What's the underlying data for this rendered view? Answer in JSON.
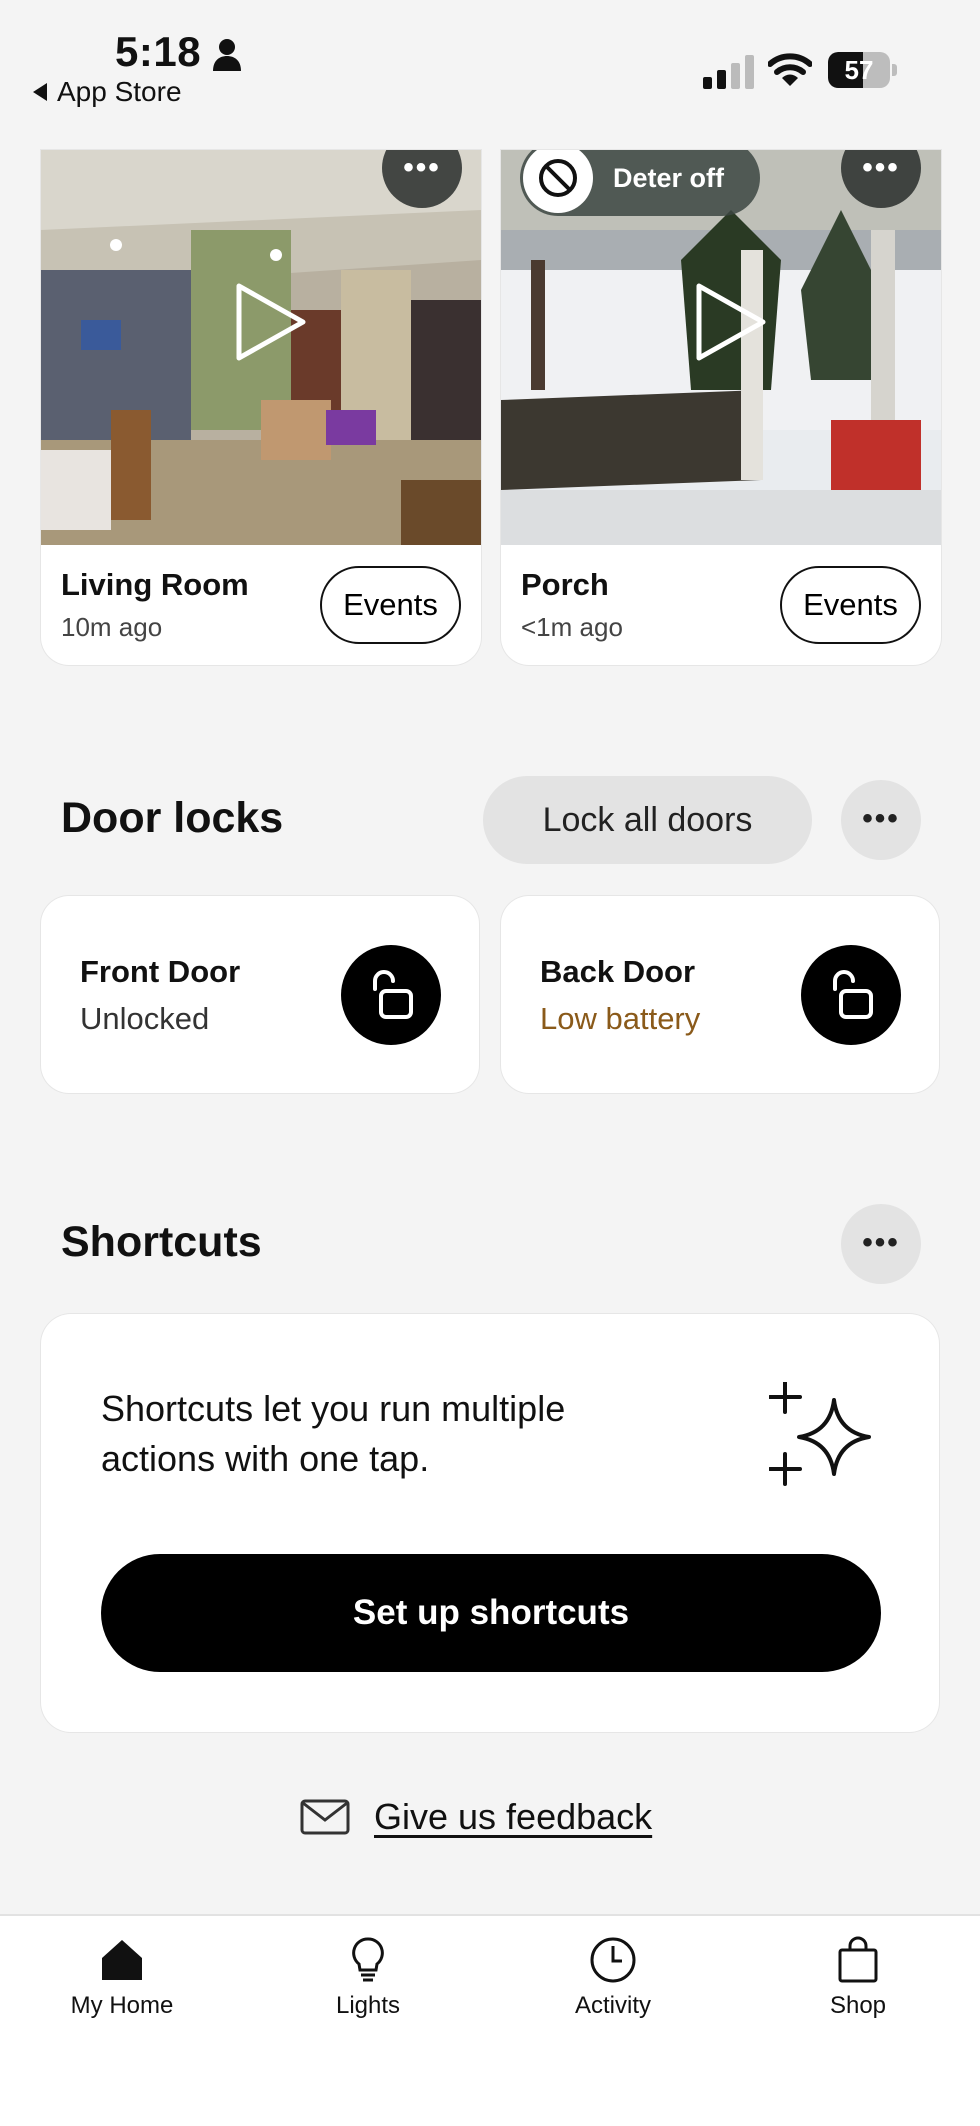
{
  "status_bar": {
    "time": "5:18",
    "back_label": "App Store",
    "battery": "57",
    "battery_level": 0.57
  },
  "cameras": [
    {
      "name": "Living Room",
      "time_ago": "10m ago",
      "events_label": "Events"
    },
    {
      "name": "Porch",
      "time_ago": "<1m ago",
      "events_label": "Events",
      "deter_label": "Deter off"
    }
  ],
  "door_locks": {
    "title": "Door locks",
    "lock_all_label": "Lock all doors",
    "locks": [
      {
        "name": "Front Door",
        "status": "Unlocked",
        "status_color": "#333333"
      },
      {
        "name": "Back Door",
        "status": "Low battery",
        "status_color": "#8a5a1a"
      }
    ]
  },
  "shortcuts": {
    "title": "Shortcuts",
    "description": "Shortcuts let you run multiple actions with one tap.",
    "setup_label": "Set up shortcuts"
  },
  "feedback_label": "Give us feedback",
  "tabs": [
    {
      "label": "My Home",
      "icon": "home-icon"
    },
    {
      "label": "Lights",
      "icon": "lightbulb-icon"
    },
    {
      "label": "Activity",
      "icon": "clock-icon"
    },
    {
      "label": "Shop",
      "icon": "shopping-bag-icon"
    }
  ]
}
